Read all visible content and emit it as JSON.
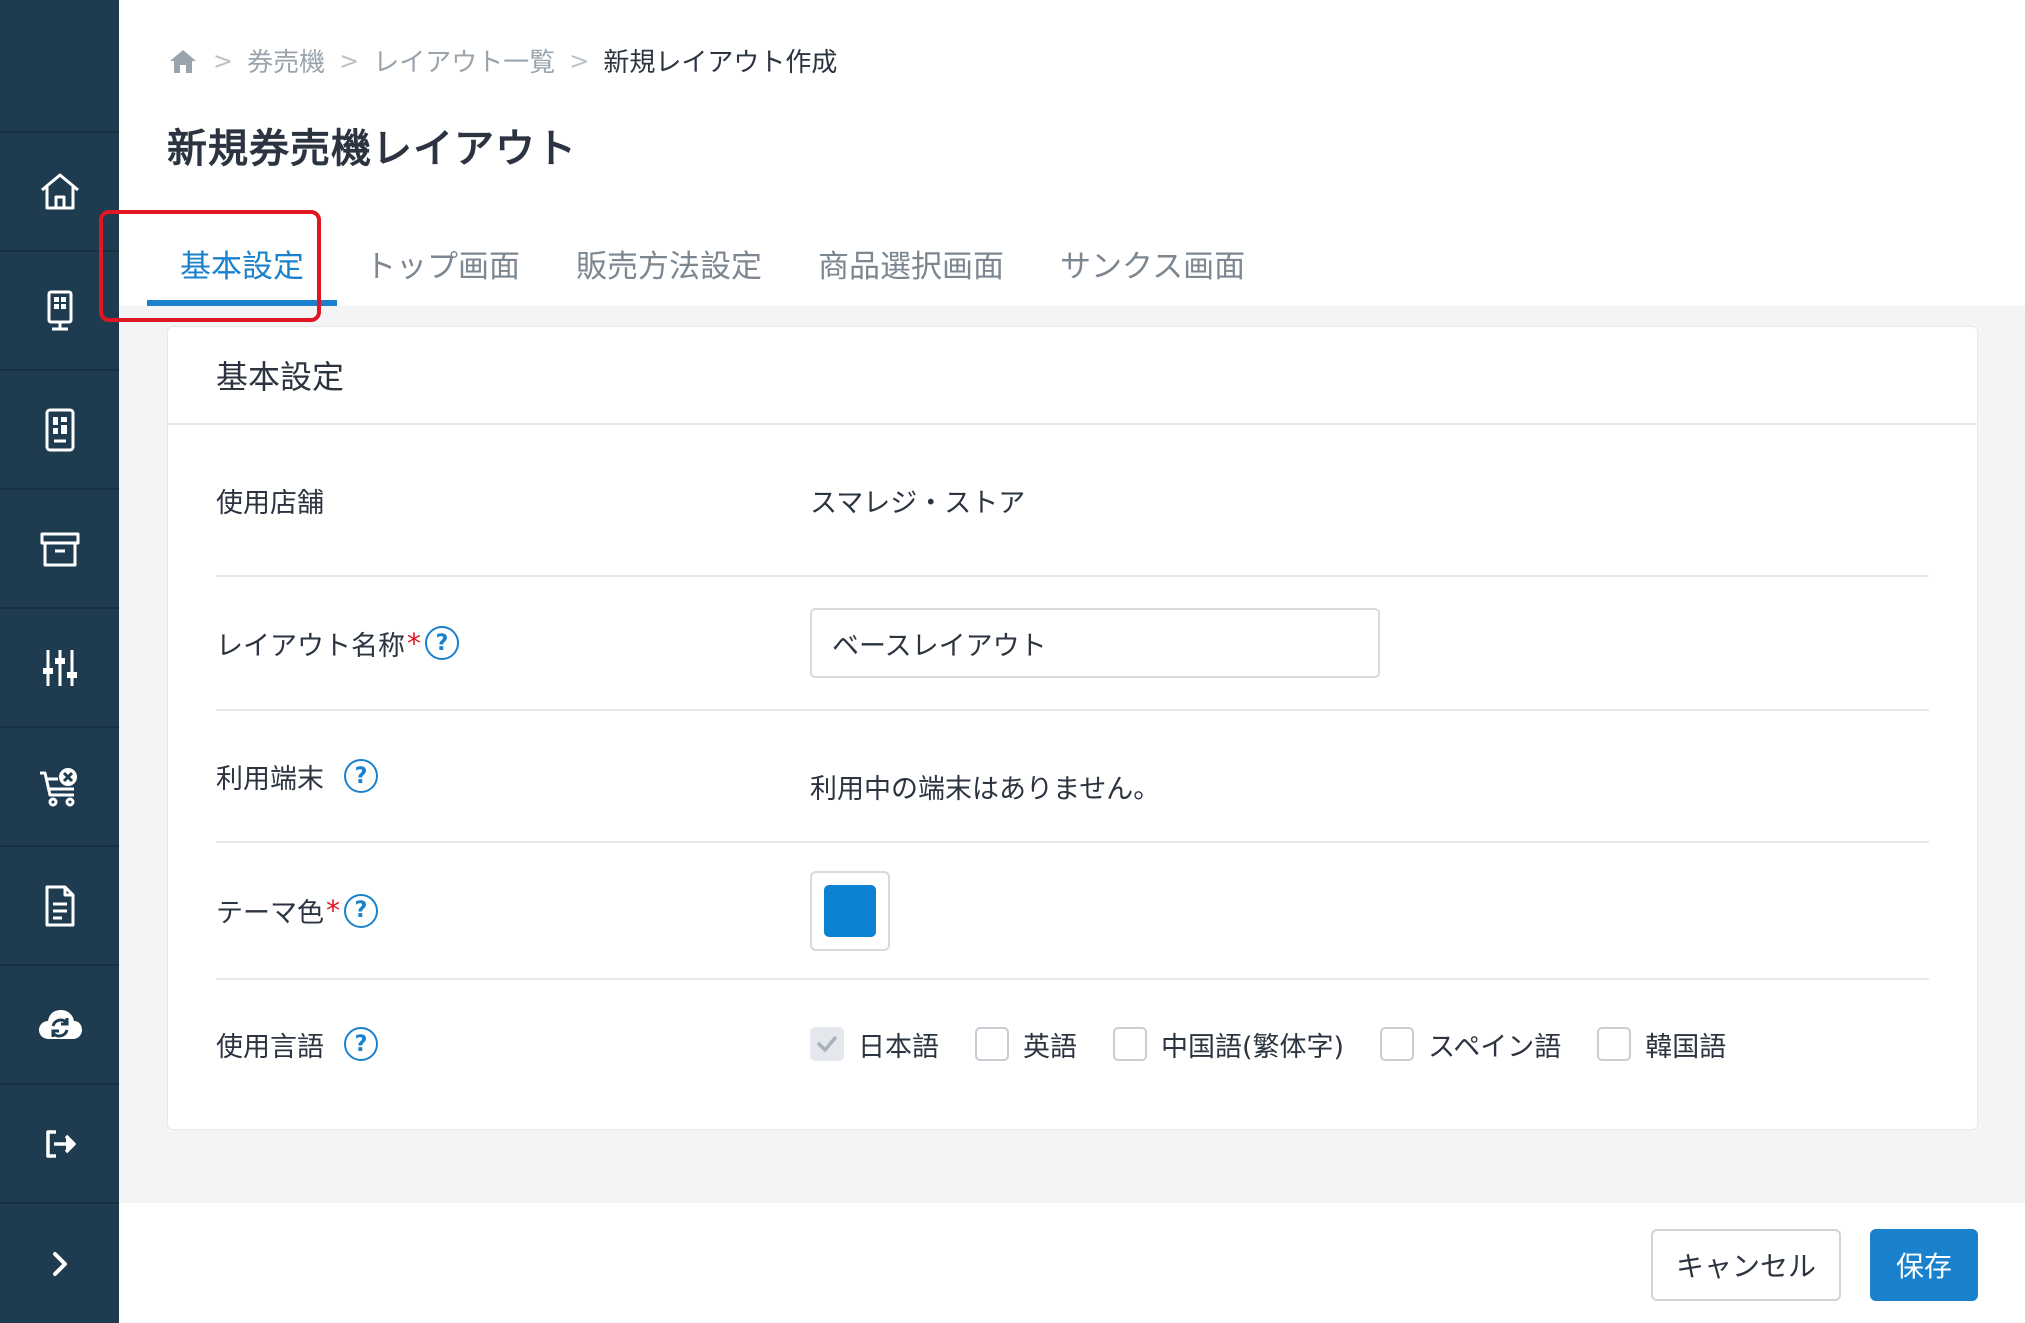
{
  "breadcrumb": {
    "items": [
      "券売機",
      "レイアウト一覧"
    ],
    "current": "新規レイアウト作成"
  },
  "page": {
    "title": "新規券売機レイアウト"
  },
  "tabs": [
    {
      "label": "基本設定",
      "active": true
    },
    {
      "label": "トップ画面"
    },
    {
      "label": "販売方法設定"
    },
    {
      "label": "商品選択画面"
    },
    {
      "label": "サンクス画面"
    }
  ],
  "card": {
    "title": "基本設定",
    "store": {
      "label": "使用店舗",
      "value": "スマレジ・ストア"
    },
    "layout_name": {
      "label": "レイアウト名称",
      "required_mark": "*",
      "value": "ベースレイアウト"
    },
    "terminal": {
      "label": "利用端末",
      "value": "利用中の端末はありません。"
    },
    "theme": {
      "label": "テーマ色",
      "required_mark": "*",
      "color": "#0b82d2"
    },
    "languages": {
      "label": "使用言語",
      "options": [
        {
          "label": "日本語",
          "checked": true
        },
        {
          "label": "英語",
          "checked": false
        },
        {
          "label": "中国語(繁体字)",
          "checked": false
        },
        {
          "label": "スペイン語",
          "checked": false
        },
        {
          "label": "韓国語",
          "checked": false
        }
      ]
    },
    "help_symbol": "?"
  },
  "footer": {
    "cancel_label": "キャンセル",
    "save_label": "保存"
  },
  "colors": {
    "accent": "#1a82cc",
    "sidebar": "#1e3b50",
    "highlight": "#e01622"
  },
  "sidebar": {
    "icons": [
      "home-icon",
      "kiosk-icon",
      "tablet-layout-icon",
      "archive-icon",
      "sliders-icon",
      "cart-cancel-icon",
      "document-icon",
      "cloud-sync-icon",
      "logout-icon",
      "chevron-right-icon"
    ]
  }
}
